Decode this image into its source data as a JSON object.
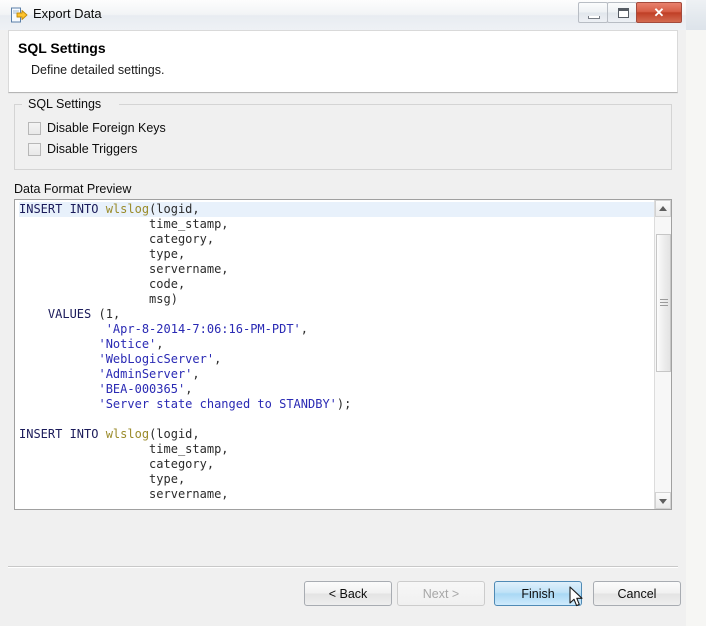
{
  "window": {
    "title": "Export Data",
    "icon": "export-document-icon",
    "controls": {
      "minimize": "—",
      "maximize": "❐",
      "close": "✕"
    }
  },
  "banner": {
    "title": "SQL Settings",
    "subtitle": "Define detailed settings."
  },
  "sql_settings_group": {
    "legend": "SQL Settings",
    "checkboxes": [
      {
        "label": "Disable Foreign Keys",
        "checked": false
      },
      {
        "label": "Disable Triggers",
        "checked": false
      }
    ]
  },
  "preview": {
    "label": "Data Format Preview",
    "lines": [
      {
        "current": true,
        "tokens": [
          {
            "t": "INSERT INTO ",
            "c": "kw"
          },
          {
            "t": "wlslog",
            "c": "tbl"
          },
          {
            "t": "(logid,",
            "c": "pln"
          }
        ]
      },
      {
        "current": false,
        "tokens": [
          {
            "t": "                  time_stamp,",
            "c": "pln"
          }
        ]
      },
      {
        "current": false,
        "tokens": [
          {
            "t": "                  category,",
            "c": "pln"
          }
        ]
      },
      {
        "current": false,
        "tokens": [
          {
            "t": "                  type,",
            "c": "pln"
          }
        ]
      },
      {
        "current": false,
        "tokens": [
          {
            "t": "                  servername,",
            "c": "pln"
          }
        ]
      },
      {
        "current": false,
        "tokens": [
          {
            "t": "                  code,",
            "c": "pln"
          }
        ]
      },
      {
        "current": false,
        "tokens": [
          {
            "t": "                  msg)",
            "c": "pln"
          }
        ]
      },
      {
        "current": false,
        "tokens": [
          {
            "t": "    ",
            "c": "pln"
          },
          {
            "t": "VALUES",
            "c": "kw"
          },
          {
            "t": " (",
            "c": "pln"
          },
          {
            "t": "1",
            "c": "num"
          },
          {
            "t": ",",
            "c": "pln"
          }
        ]
      },
      {
        "current": false,
        "tokens": [
          {
            "t": "            ",
            "c": "pln"
          },
          {
            "t": "'Apr-8-2014-7:06:16-PM-PDT'",
            "c": "str"
          },
          {
            "t": ",",
            "c": "pln"
          }
        ]
      },
      {
        "current": false,
        "tokens": [
          {
            "t": "           ",
            "c": "pln"
          },
          {
            "t": "'Notice'",
            "c": "str"
          },
          {
            "t": ",",
            "c": "pln"
          }
        ]
      },
      {
        "current": false,
        "tokens": [
          {
            "t": "           ",
            "c": "pln"
          },
          {
            "t": "'WebLogicServer'",
            "c": "str"
          },
          {
            "t": ",",
            "c": "pln"
          }
        ]
      },
      {
        "current": false,
        "tokens": [
          {
            "t": "           ",
            "c": "pln"
          },
          {
            "t": "'AdminServer'",
            "c": "str"
          },
          {
            "t": ",",
            "c": "pln"
          }
        ]
      },
      {
        "current": false,
        "tokens": [
          {
            "t": "           ",
            "c": "pln"
          },
          {
            "t": "'BEA-000365'",
            "c": "str"
          },
          {
            "t": ",",
            "c": "pln"
          }
        ]
      },
      {
        "current": false,
        "tokens": [
          {
            "t": "           ",
            "c": "pln"
          },
          {
            "t": "'Server state changed to STANDBY'",
            "c": "str"
          },
          {
            "t": ");",
            "c": "pln"
          }
        ]
      },
      {
        "current": false,
        "tokens": [
          {
            "t": "",
            "c": "pln"
          }
        ]
      },
      {
        "current": false,
        "tokens": [
          {
            "t": "INSERT INTO ",
            "c": "kw"
          },
          {
            "t": "wlslog",
            "c": "tbl"
          },
          {
            "t": "(logid,",
            "c": "pln"
          }
        ]
      },
      {
        "current": false,
        "tokens": [
          {
            "t": "                  time_stamp,",
            "c": "pln"
          }
        ]
      },
      {
        "current": false,
        "tokens": [
          {
            "t": "                  category,",
            "c": "pln"
          }
        ]
      },
      {
        "current": false,
        "tokens": [
          {
            "t": "                  type,",
            "c": "pln"
          }
        ]
      },
      {
        "current": false,
        "tokens": [
          {
            "t": "                  servername,",
            "c": "pln"
          }
        ]
      }
    ],
    "scrollbar": {
      "up_arrow": "▲",
      "down_arrow": "▼",
      "thumb_top_pct": 6,
      "thumb_height_pct": 50
    }
  },
  "buttons": {
    "back": {
      "label": "< Back",
      "enabled": true,
      "state": "normal"
    },
    "next": {
      "label": "Next >",
      "enabled": false,
      "state": "disabled"
    },
    "finish": {
      "label": "Finish",
      "enabled": true,
      "state": "hover"
    },
    "cancel": {
      "label": "Cancel",
      "enabled": true,
      "state": "normal"
    }
  },
  "colors": {
    "dialog_bg": "#f0f0f0",
    "banner_bg": "#ffffff",
    "keyword": "#1b1b5a",
    "table_name": "#9a8b2a",
    "string_literal": "#2a2ab4",
    "current_line": "#e8f1fb",
    "finish_hover": "#a9d8f4",
    "close_button": "#c03f26"
  }
}
